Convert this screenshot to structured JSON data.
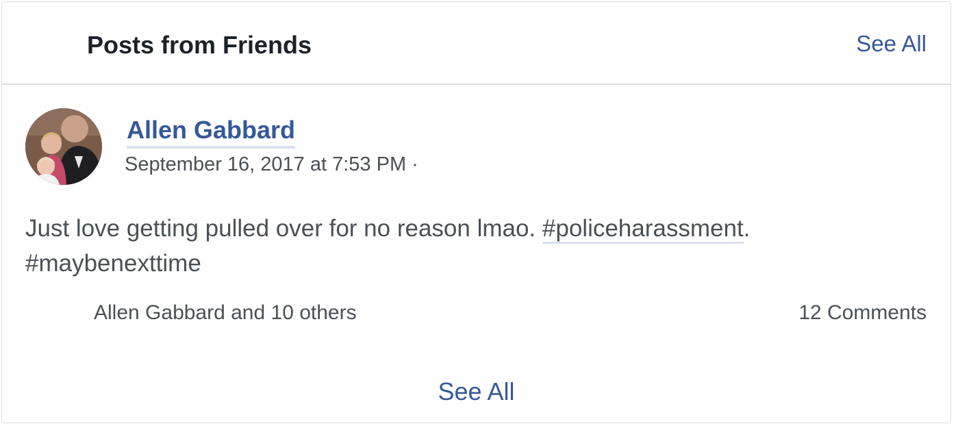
{
  "section": {
    "title": "Posts from Friends",
    "see_all_label": "See All"
  },
  "post": {
    "avatar_icon": "profile-photo",
    "author": "Allen Gabbard",
    "timestamp": "September 16, 2017 at 7:53 PM ·",
    "text_prefix": "Just love getting pulled over for no reason lmao. ",
    "hashtag_1": "#policeharassment",
    "text_separator": ".",
    "hashtag_2": "#maybenexttime",
    "likes_summary": "Allen Gabbard and 10 others",
    "comments_count": "12 Comments"
  },
  "footer": {
    "see_all_label": "See All"
  },
  "colors": {
    "link": "#365899",
    "text": "#4b4f56",
    "heading": "#1d2129",
    "border": "#dddfe2"
  }
}
